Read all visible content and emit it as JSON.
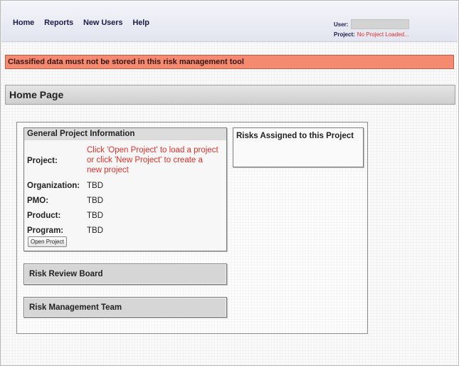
{
  "nav": {
    "items": [
      {
        "label": "Home"
      },
      {
        "label": "Reports"
      },
      {
        "label": "New Users"
      },
      {
        "label": "Help"
      }
    ]
  },
  "user": {
    "label": "User:",
    "project_label": "Project:",
    "project_value": "No Project Loaded..."
  },
  "banner": {
    "text": "Classified data must not be stored in this risk management tool"
  },
  "page": {
    "title": "Home Page"
  },
  "general_info": {
    "title": "General Project Information",
    "project_label": "Project:",
    "project_message": "Click 'Open Project' to load a project or click 'New Project' to create a new project",
    "organization_label": "Organization:",
    "organization_value": "TBD",
    "pmo_label": "PMO:",
    "pmo_value": "TBD",
    "product_label": "Product:",
    "product_value": "TBD",
    "program_label": "Program:",
    "program_value": "TBD",
    "open_button": "Open Project"
  },
  "risks_panel": {
    "title": "Risks Assigned to this Project"
  },
  "risk_review_board": {
    "title": "Risk Review Board"
  },
  "risk_management_team": {
    "title": "Risk Management Team"
  },
  "colors": {
    "banner_bg": "#f48a70",
    "message_red": "#e0302a",
    "nav_text": "#1c1c4a"
  }
}
